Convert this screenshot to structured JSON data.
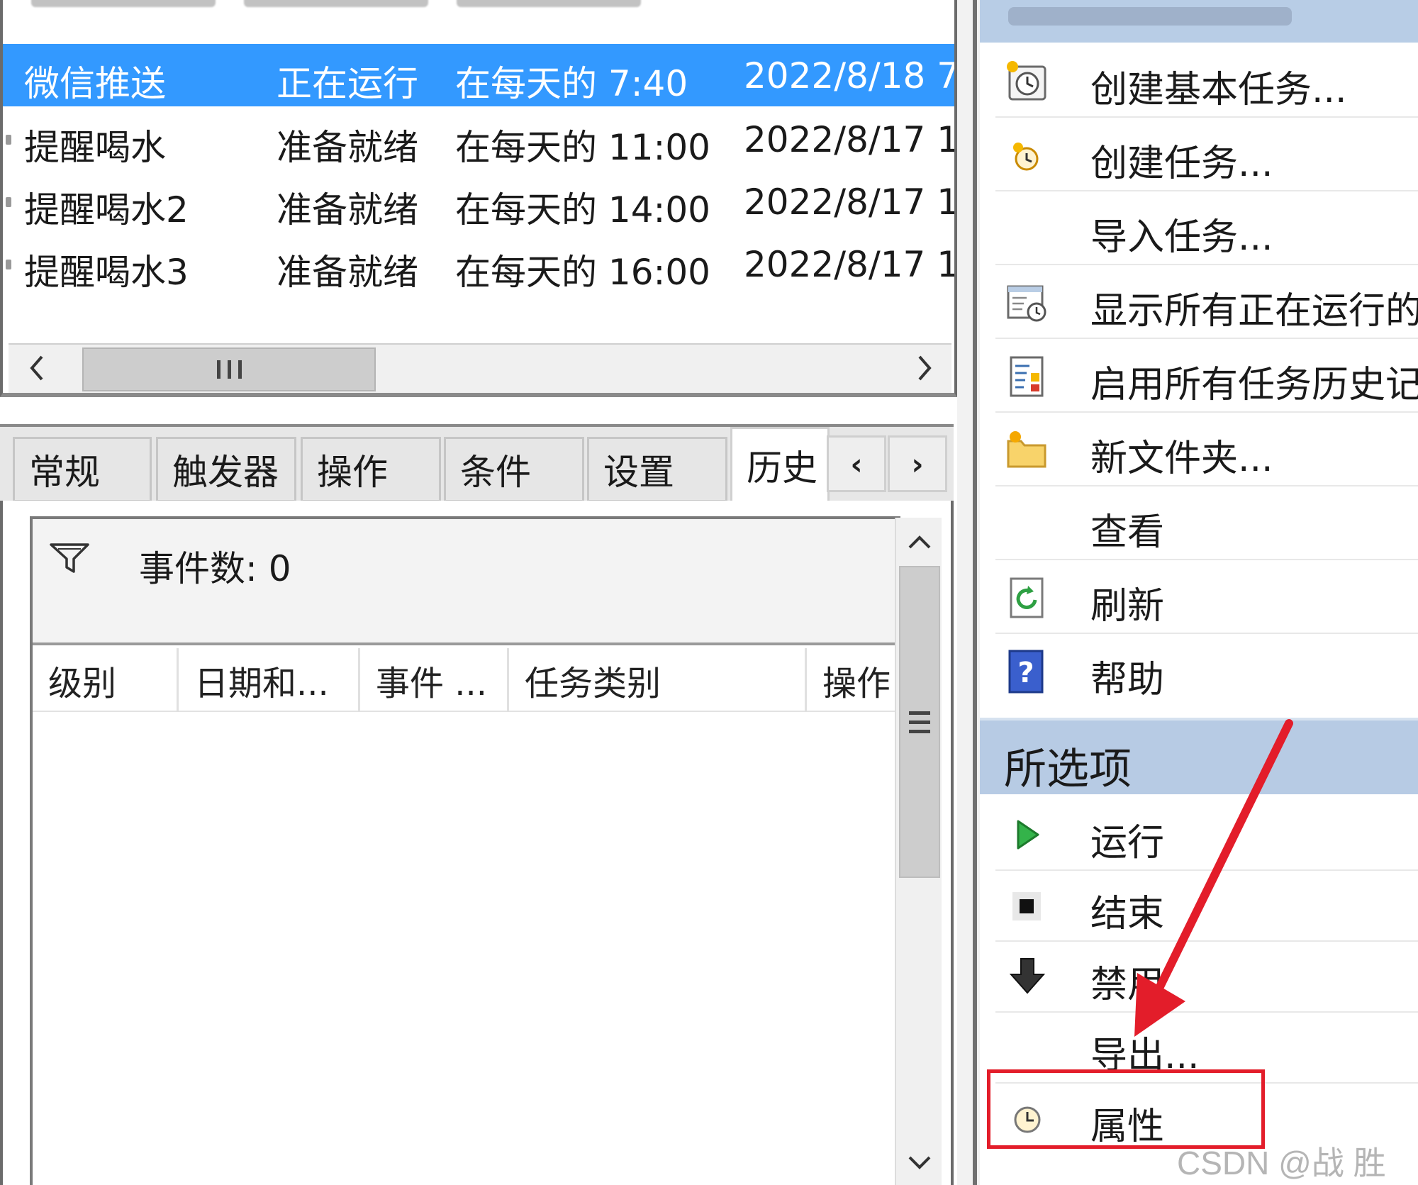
{
  "task_list": {
    "rows": [
      {
        "name": "微信推送",
        "status": "正在运行",
        "trigger": "在每天的 7:40",
        "next_run": "2022/8/18 7",
        "selected": true
      },
      {
        "name": "提醒喝水",
        "status": "准备就绪",
        "trigger": "在每天的 11:00",
        "next_run": "2022/8/17 1",
        "selected": false
      },
      {
        "name": "提醒喝水2",
        "status": "准备就绪",
        "trigger": "在每天的 14:00",
        "next_run": "2022/8/17 1",
        "selected": false
      },
      {
        "name": "提醒喝水3",
        "status": "准备就绪",
        "trigger": "在每天的 16:00",
        "next_run": "2022/8/17 1",
        "selected": false
      }
    ]
  },
  "detail": {
    "tabs": [
      "常规",
      "触发器",
      "操作",
      "条件",
      "设置",
      "历史"
    ],
    "active_tab": "历史",
    "history": {
      "event_count": "事件数: 0",
      "columns": [
        "级别",
        "日期和...",
        "事件 ...",
        "任务类别",
        "操作"
      ]
    }
  },
  "actions_pane": {
    "top_items": [
      {
        "label": "创建基本任务...",
        "icon": "create-basic-task-icon"
      },
      {
        "label": "创建任务...",
        "icon": "create-task-icon"
      },
      {
        "label": "导入任务...",
        "icon": ""
      },
      {
        "label": "显示所有正在运行的任务",
        "icon": "running-tasks-icon"
      },
      {
        "label": "启用所有任务历史记录",
        "icon": "task-history-icon"
      },
      {
        "label": "新文件夹...",
        "icon": "new-folder-icon"
      },
      {
        "label": "查看",
        "icon": ""
      },
      {
        "label": "刷新",
        "icon": "refresh-icon"
      },
      {
        "label": "帮助",
        "icon": "help-icon"
      }
    ],
    "selected_section": {
      "title": "所选项",
      "items": [
        {
          "label": "运行",
          "icon": "run-icon"
        },
        {
          "label": "结束",
          "icon": "stop-icon"
        },
        {
          "label": "禁用",
          "icon": "disable-icon"
        },
        {
          "label": "导出...",
          "icon": ""
        },
        {
          "label": "属性",
          "icon": "properties-icon"
        }
      ]
    }
  },
  "annotation": {
    "highlight_color": "#e31d2a",
    "watermark": "CSDN @战 胜"
  }
}
